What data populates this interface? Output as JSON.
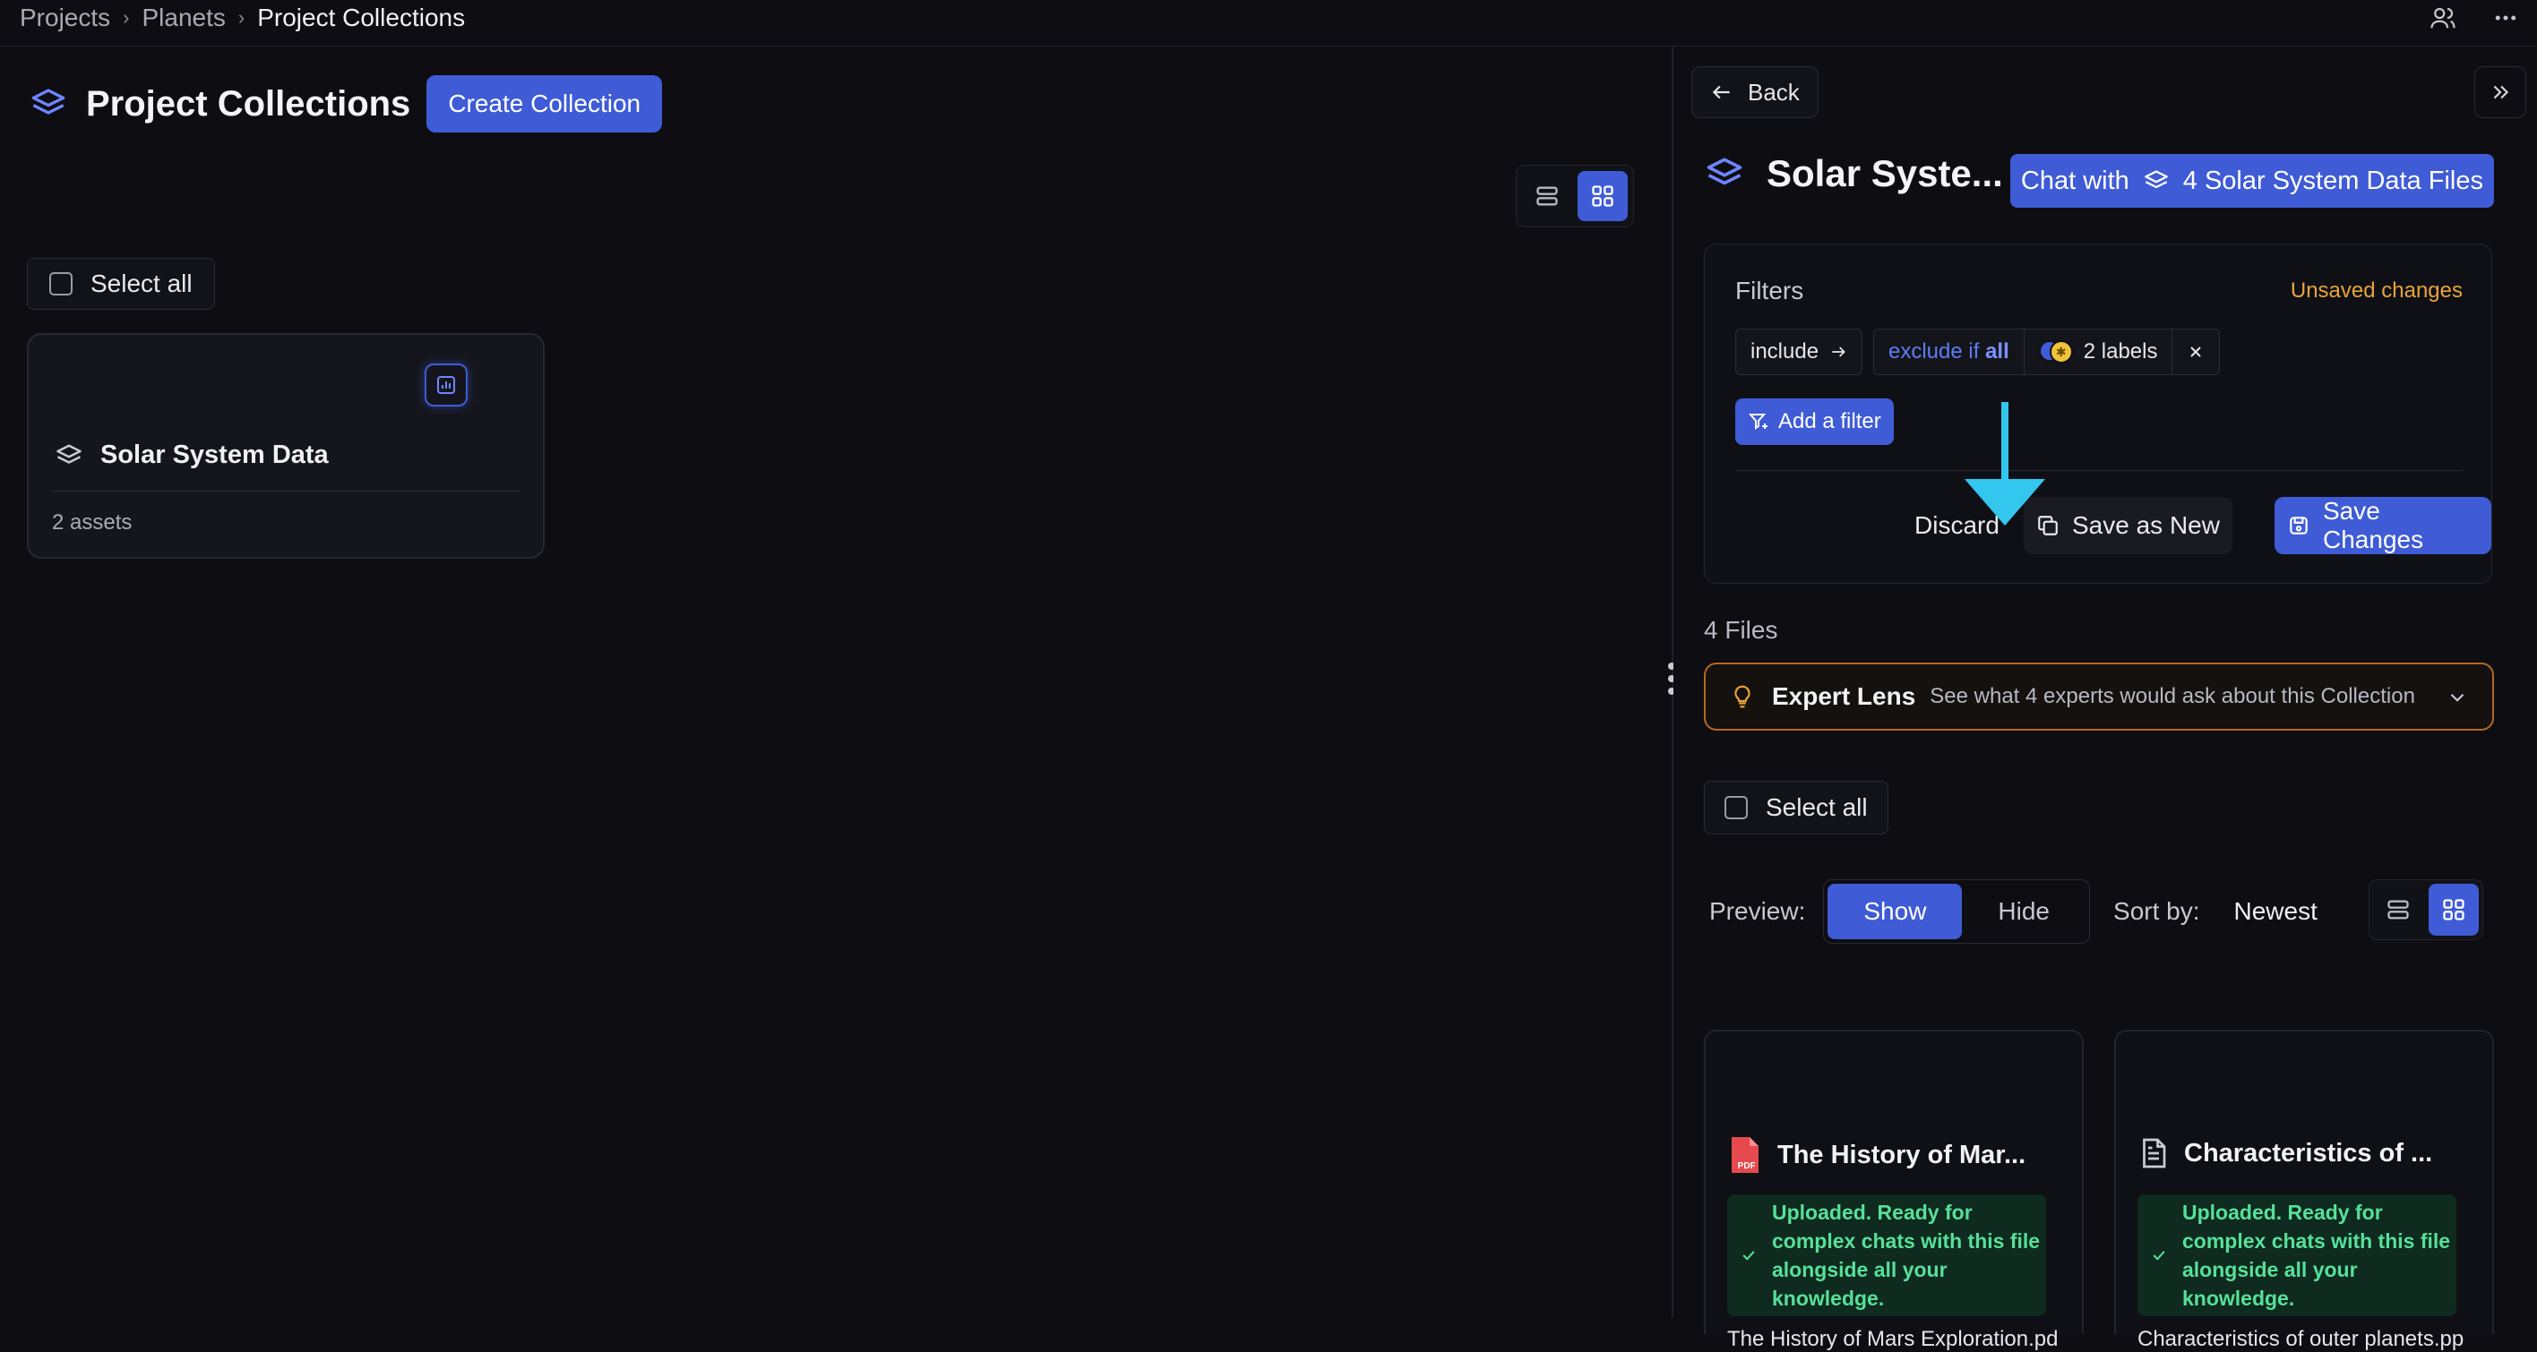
{
  "breadcrumb": {
    "items": [
      "Projects",
      "Planets",
      "Project Collections"
    ]
  },
  "left": {
    "title": "Project Collections",
    "create_button": "Create Collection",
    "select_all": "Select all",
    "collection": {
      "name": "Solar System Data",
      "assets": "2 assets"
    }
  },
  "panel": {
    "back": "Back",
    "title": "Solar Syste...",
    "chat_prefix": "Chat with",
    "chat_target": "4 Solar System Data Files",
    "filters": {
      "label": "Filters",
      "unsaved": "Unsaved changes",
      "include": "include",
      "exclude_prefix": "exclude if",
      "exclude_mode": "all",
      "labels_count": "2 labels",
      "add_filter": "Add a filter",
      "discard": "Discard",
      "save_as_new": "Save as New",
      "save_changes": "Save Changes"
    },
    "files_count": "4 Files",
    "expert_lens": {
      "title": "Expert Lens",
      "subtitle": "See what 4 experts would ask about this Collection"
    },
    "select_all": "Select all",
    "preview": {
      "label": "Preview:",
      "show": "Show",
      "hide": "Hide",
      "active": "Show"
    },
    "sort": {
      "label": "Sort by:",
      "value": "Newest"
    },
    "files": [
      {
        "title": "The History of Mar...",
        "type_icon": "pdf-file-icon",
        "status": "Uploaded. Ready for complex chats with this file alongside all your knowledge.",
        "description": "The History of Mars Exploration.pd"
      },
      {
        "title": "Characteristics of ...",
        "type_icon": "document-file-icon",
        "status": "Uploaded. Ready for complex chats with this file alongside all your knowledge.",
        "description": "Characteristics of outer planets.pp"
      }
    ]
  },
  "colors": {
    "accent": "#3f5bd6",
    "warning": "#e8a33a",
    "success": "#56e09a",
    "annotation_arrow": "#33c6ee"
  }
}
